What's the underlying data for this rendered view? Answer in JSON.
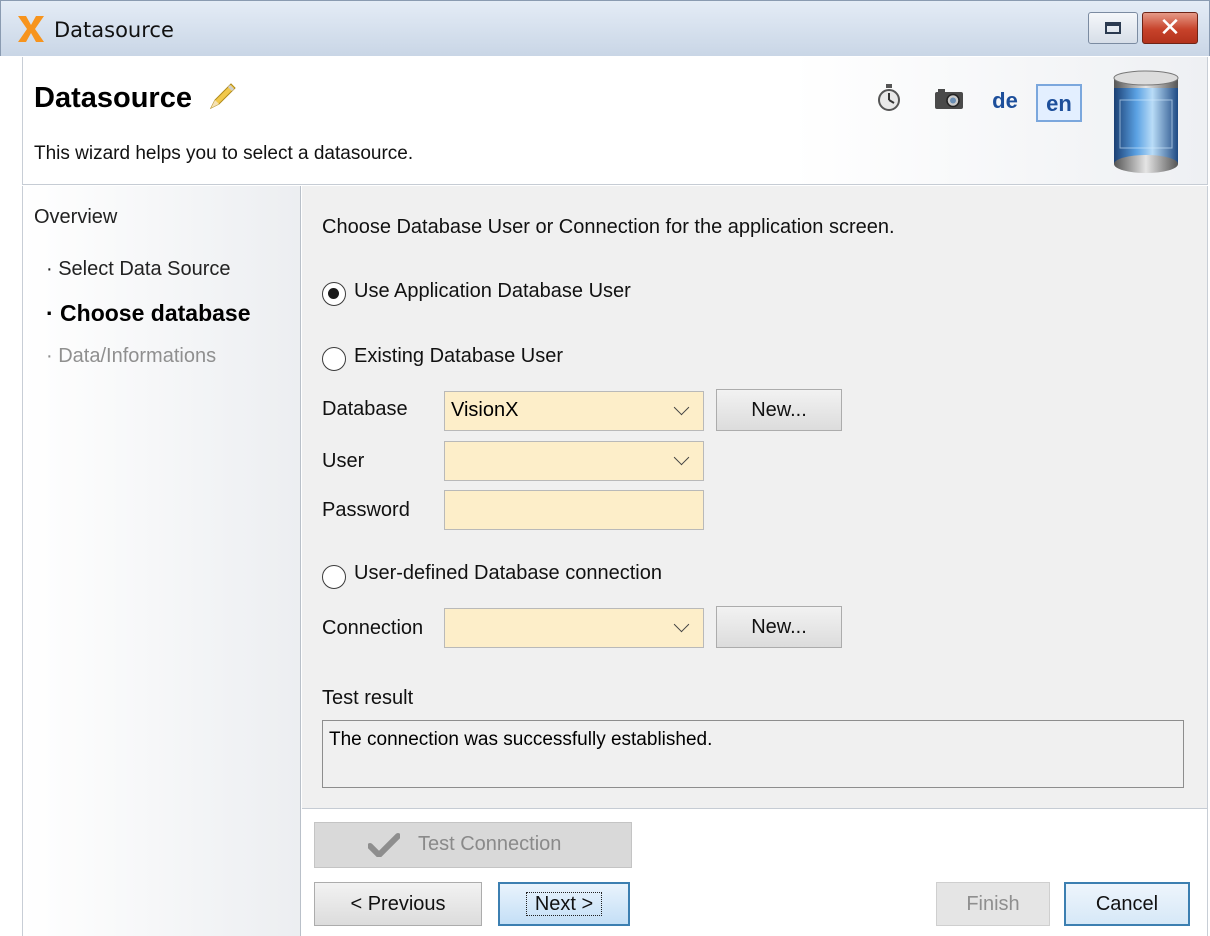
{
  "window": {
    "title": "Datasource",
    "close_glyph": "✕"
  },
  "header": {
    "title": "Datasource",
    "subtitle": "This wizard helps you to select a datasource.",
    "languages": [
      "de",
      "en"
    ],
    "selected_language": "en"
  },
  "nav": {
    "overview": "Overview",
    "steps": [
      {
        "label": "· Select Data Source",
        "state": "done"
      },
      {
        "label": "· Choose database",
        "state": "active"
      },
      {
        "label": "· Data/Informations",
        "state": "disabled"
      }
    ]
  },
  "form": {
    "intro": "Choose Database User or Connection for the application screen.",
    "options": {
      "app_user": {
        "label": "Use Application Database User",
        "selected": true
      },
      "existing_user": {
        "label": "Existing Database User",
        "selected": false
      },
      "user_defined": {
        "label": "User-defined Database connection",
        "selected": false
      }
    },
    "database": {
      "label": "Database",
      "value": "VisionX",
      "new_label": "New..."
    },
    "user": {
      "label": "User",
      "value": ""
    },
    "password": {
      "label": "Password",
      "value": ""
    },
    "connection": {
      "label": "Connection",
      "value": "",
      "new_label": "New..."
    },
    "test_result": {
      "label": "Test result",
      "text": "The connection was successfully established."
    }
  },
  "buttons": {
    "test_connection": "Test Connection",
    "previous": "< Previous",
    "next": "Next >",
    "finish": "Finish",
    "cancel": "Cancel"
  },
  "colors": {
    "field_bg": "#fdeec9",
    "accent_border": "#3c7fb1",
    "link_blue": "#1d4f9b",
    "app_logo": "#f7941d"
  },
  "icons": {
    "app": "app-x-logo-icon",
    "title_decoration": "pencil-icon",
    "toolbar": [
      "stopwatch-icon",
      "camera-icon"
    ],
    "header_image": "database-cylinder-icon",
    "test_button": "check-icon"
  }
}
